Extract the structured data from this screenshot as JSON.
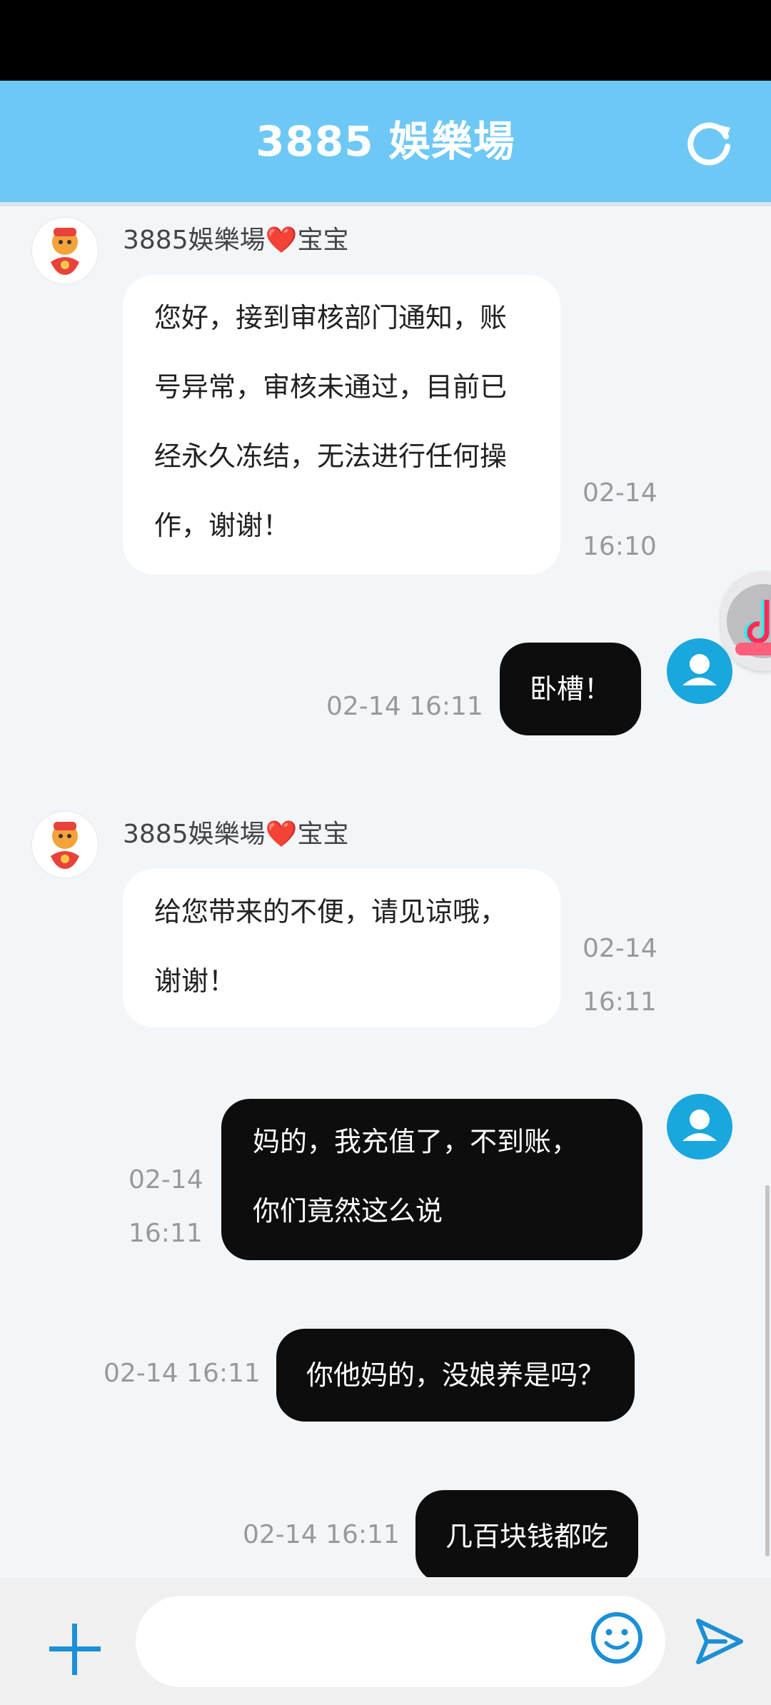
{
  "header": {
    "title": "3885 娛樂場"
  },
  "messages": [
    {
      "sender": {
        "name": "3885娛樂場",
        "heart": "❤️",
        "suffix": "宝宝"
      },
      "lines": [
        "您好，接到审核部门通知，账",
        "号异常，审核未通过，目前已",
        "经永久冻结，无法进行任何操",
        "作，谢谢！"
      ],
      "time_date": "02-14",
      "time_clock": "16:10"
    },
    {
      "text": "卧槽！",
      "time": "02-14 16:11"
    },
    {
      "sender": {
        "name": "3885娛樂場",
        "heart": "❤️",
        "suffix": "宝宝"
      },
      "lines": [
        "给您带来的不便，请见谅哦，",
        "谢谢！"
      ],
      "time_date": "02-14",
      "time_clock": "16:11"
    },
    {
      "lines": [
        "妈的，我充值了，不到账，",
        "你们竟然这么说"
      ],
      "time_date": "02-14",
      "time_clock": "16:11"
    },
    {
      "text": "你他妈的，没娘养是吗？",
      "time": "02-14 16:11"
    },
    {
      "text": "几百块钱都吃",
      "time": "02-14 16:11"
    }
  ],
  "input": {
    "placeholder": ""
  },
  "colors": {
    "header": "#6ec8f5",
    "user_avatar": "#19a7dd",
    "outgoing_bubble": "#0d0d0d",
    "incoming_bubble": "#ffffff",
    "icon_blue": "#1c8fd6"
  }
}
